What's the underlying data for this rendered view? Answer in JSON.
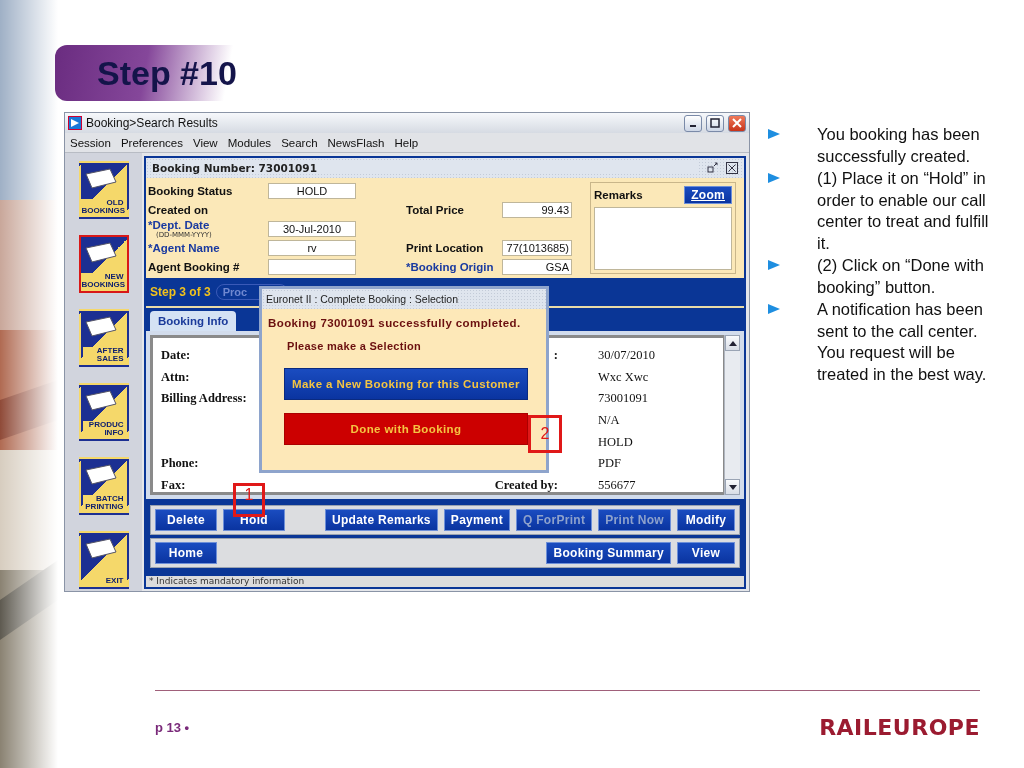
{
  "slide": {
    "title": "Step #10",
    "page": "p 13 •",
    "logo": "RAILEUROPE"
  },
  "window": {
    "title": "Booking>Search Results"
  },
  "menu": [
    "Session",
    "Preferences",
    "View",
    "Modules",
    "Search",
    "NewsFlash",
    "Help"
  ],
  "sidebar": {
    "items": [
      {
        "label": "OLD BOOKINGS",
        "selected": false
      },
      {
        "label": "NEW BOOKINGS",
        "selected": true
      },
      {
        "label": "AFTER SALES",
        "selected": false
      },
      {
        "label": "PRODUC INFO",
        "selected": false
      },
      {
        "label": "BATCH PRINTING",
        "selected": false
      },
      {
        "label": "EXIT",
        "selected": false
      }
    ]
  },
  "booking_header": {
    "title": "Booking Number: 73001091"
  },
  "form": {
    "rows": [
      {
        "left": {
          "kind": "input",
          "label": "Booking Status",
          "value": "HOLD",
          "required": false
        }
      },
      {
        "left": {
          "kind": "text",
          "label": "Created on",
          "required": false
        },
        "right": {
          "kind": "input",
          "label": "Total Price",
          "value": "99.43",
          "required": false
        }
      },
      {
        "left": {
          "kind": "input",
          "label": "*Dept. Date",
          "hint": "(DD-MMM-YYYY)",
          "value": "30-Jul-2010",
          "required": true
        }
      },
      {
        "left": {
          "kind": "input",
          "label": "*Agent Name",
          "value": "rv",
          "required": true
        },
        "right": {
          "kind": "input",
          "label": "Print Location",
          "value": "77(1013685)",
          "required": false
        }
      },
      {
        "left": {
          "kind": "input",
          "label": "Agent Booking #",
          "required": false
        },
        "right": {
          "kind": "input",
          "label": "*Booking Origin",
          "value": "GSA",
          "required": true
        }
      }
    ],
    "remarks": {
      "label": "Remarks",
      "button": "Zoom"
    }
  },
  "step_bar": {
    "text": "Step 3 of 3",
    "pill": "Proc"
  },
  "tabs": [
    {
      "label": "Booking Info",
      "selected": true
    }
  ],
  "details": {
    "rows": [
      {
        "label": "Date:",
        "label_2": ":",
        "value": "30/07/2010"
      },
      {
        "label": "Attn:",
        "value": "Wxc Xwc"
      },
      {
        "label": "Billing Address:",
        "value": "73001091"
      },
      {
        "value": "N/A"
      },
      {
        "value": "HOLD"
      },
      {
        "label": "Phone:",
        "value": "PDF"
      },
      {
        "label": "Fax:",
        "label_2": "Created by:",
        "value": "556677"
      }
    ]
  },
  "button_rows": [
    {
      "left": [
        {
          "label": "Delete",
          "disabled": false
        },
        {
          "label": "Hold",
          "disabled": false
        }
      ],
      "right": [
        {
          "label": "Update Remarks",
          "disabled": false
        },
        {
          "label": "Payment",
          "disabled": false
        },
        {
          "label": "Q ForPrint",
          "disabled": true
        },
        {
          "label": "Print Now",
          "disabled": true
        },
        {
          "label": "Modify",
          "disabled": false
        }
      ]
    },
    {
      "left": [
        {
          "label": "Home",
          "disabled": false
        }
      ],
      "right": [
        {
          "label": "Booking Summary",
          "disabled": false
        },
        {
          "label": "View",
          "disabled": false
        }
      ]
    }
  ],
  "footnote": "* Indicates mandatory information",
  "dialog": {
    "title": "Euronet II : Complete Booking : Selection",
    "message": "Booking 73001091 successfully completed.",
    "prompt": "Please make a Selection",
    "actions": [
      {
        "label": "Make a New Booking for this Customer",
        "kind": "primary"
      },
      {
        "label": "Done with Booking",
        "kind": "danger"
      }
    ]
  },
  "annotations": [
    {
      "number": "1"
    },
    {
      "number": "2"
    }
  ],
  "bullets": [
    "You booking has been successfully created.",
    "(1)  Place it on “Hold” in order to enable our call center to treat and fulfill it.",
    "(2) Click on “Done with booking” button.",
    "A notification has been sent to the call center. You request will be treated in the best way."
  ]
}
